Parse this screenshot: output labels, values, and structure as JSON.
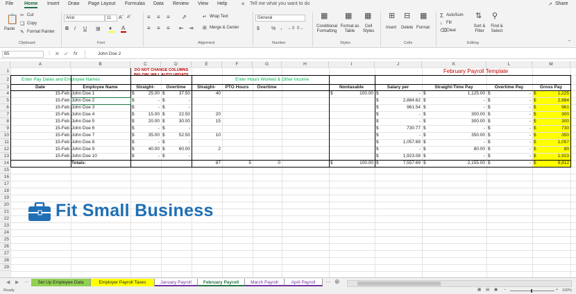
{
  "menu": {
    "tabs": [
      "File",
      "Home",
      "Insert",
      "Draw",
      "Page Layout",
      "Formulas",
      "Data",
      "Review",
      "View",
      "Help"
    ],
    "tell_me": "Tell me what you want to do",
    "share": "Share"
  },
  "ribbon": {
    "clipboard": {
      "paste": "Paste",
      "cut": "Cut",
      "copy": "Copy",
      "format_painter": "Format Painter",
      "label": "Clipboard"
    },
    "font": {
      "name": "Arial",
      "size": "11",
      "label": "Font",
      "bold": "B",
      "italic": "I",
      "underline": "U"
    },
    "alignment": {
      "wrap_text": "Wrap Text",
      "merge": "Merge & Center",
      "label": "Alignment"
    },
    "number": {
      "format": "General",
      "currency": "$",
      "percent": "%",
      "comma": ",",
      "label": "Number"
    },
    "styles": {
      "conditional": "Conditional Formatting",
      "format_table": "Format as Table",
      "cell_styles": "Cell Styles",
      "label": "Styles"
    },
    "cells": {
      "insert": "Insert",
      "delete": "Delete",
      "format": "Format",
      "label": "Cells"
    },
    "editing": {
      "autosum": "AutoSum",
      "fill": "Fill",
      "clear": "Clear",
      "sort": "Sort & Filter",
      "find": "Find & Select",
      "label": "Editing"
    }
  },
  "formula_bar": {
    "name_box": "B5",
    "fx": "fx",
    "content": "John Doe 2"
  },
  "columns": [
    "A",
    "B",
    "C",
    "D",
    "E",
    "F",
    "G",
    "H",
    "I",
    "J",
    "K",
    "L",
    "M"
  ],
  "rows": [
    "1",
    "2",
    "3",
    "4",
    "5",
    "6",
    "7",
    "8",
    "9",
    "10",
    "11",
    "12",
    "13",
    "14",
    "15",
    "16",
    "17",
    "18",
    "19",
    "20",
    "21",
    "22",
    "23",
    "24",
    "25",
    "26",
    "27",
    "28",
    "29"
  ],
  "sheet": {
    "title": "February Payroll Template",
    "section_left": "Enter Pay Dates and Employee Names",
    "warning": "DO NOT CHANGE COLUMNS BELOW; WILL AUTO UPDATE",
    "section_right": "Enter Hours Worked & Other Income",
    "headers": [
      "Date",
      "Employee Name",
      "Straight-",
      "Overtime",
      "Straight-",
      "PTO Hours",
      "Overtime",
      "",
      "Nontaxable",
      "Salary per",
      "Straight-Time Pay",
      "Overtime Pay",
      "Gross Pay"
    ],
    "data_rows": [
      [
        "15-Feb",
        "John Doe 1",
        "25.00",
        "37.50",
        "40",
        "",
        "",
        "",
        "100.00",
        "-",
        "1,125.00",
        "-",
        "1,225"
      ],
      [
        "15-Feb",
        "John Doe 2",
        "-",
        "-",
        "",
        "",
        "",
        "",
        "",
        "2,884.62",
        "-",
        "-",
        "2,884"
      ],
      [
        "15-Feb",
        "John Doe 3",
        "-",
        "-",
        "",
        "",
        "",
        "",
        "",
        "961.54",
        "-",
        "-",
        "961"
      ],
      [
        "15-Feb",
        "John Doe 4",
        "15.00",
        "22.50",
        "20",
        "",
        "",
        "",
        "",
        "-",
        "300.00",
        "-",
        "300"
      ],
      [
        "15-Feb",
        "John Doe 5",
        "20.00",
        "30.00",
        "15",
        "",
        "",
        "",
        "",
        "-",
        "300.00",
        "-",
        "300"
      ],
      [
        "15-Feb",
        "John Doe 6",
        "-",
        "-",
        "",
        "",
        "",
        "",
        "",
        "730.77",
        "-",
        "-",
        "730"
      ],
      [
        "15-Feb",
        "John Doe 7",
        "35.00",
        "52.50",
        "10",
        "",
        "",
        "",
        "",
        "-",
        "350.00",
        "-",
        "350"
      ],
      [
        "15-Feb",
        "John Doe 8",
        "-",
        "-",
        "",
        "",
        "",
        "",
        "",
        "1,057.69",
        "-",
        "-",
        "1,057"
      ],
      [
        "15-Feb",
        "John Doe 9",
        "40.00",
        "60.00",
        "2",
        "",
        "",
        "",
        "",
        "-",
        "80.00",
        "-",
        "80"
      ],
      [
        "15-Feb",
        "John Doe 10",
        "-",
        "-",
        "",
        "",
        "",
        "",
        "",
        "1,923.08",
        "-",
        "-",
        "1,923"
      ]
    ],
    "totals": {
      "label": "Totals:",
      "e": "87",
      "f": "5",
      "g": "0",
      "i": "100.00",
      "j": "7,557.69",
      "k": "2,155.00",
      "l": "-",
      "m": "9,812"
    },
    "watermark": "Fit Small Business"
  },
  "tabs": [
    {
      "label": "Set Up Employee Data",
      "color": "#92d050"
    },
    {
      "label": "Employer Payroll Taxes",
      "color": "#ffff00"
    },
    {
      "label": "January Payroll",
      "color": "#7030a0"
    },
    {
      "label": "February Payroll",
      "color": "#ffffff"
    },
    {
      "label": "March Payroll",
      "color": "#7030a0"
    },
    {
      "label": "April Payroll",
      "color": "#7030a0"
    }
  ],
  "status": {
    "ready": "Ready",
    "zoom": "100%"
  },
  "colors": {
    "accent": "#217346",
    "title_red": "#c00000",
    "section_green": "#00b050",
    "logo_blue": "#1f6fb5"
  }
}
